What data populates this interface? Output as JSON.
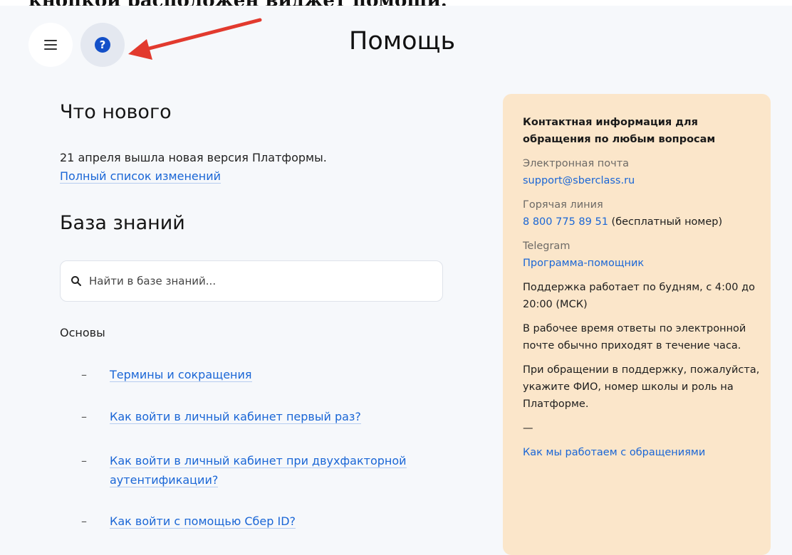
{
  "caption": "кнопкой расположен виджет помощи.",
  "header": {
    "title": "Помощь"
  },
  "whats_new": {
    "heading": "Что нового",
    "text": "21 апреля вышла новая версия Платформы.",
    "link": "Полный список изменений"
  },
  "knowledge_base": {
    "heading": "База знаний",
    "search_placeholder": "Найти в базе знаний...",
    "section": "Основы",
    "items": [
      {
        "label": "Термины и сокращения"
      },
      {
        "label": "Как войти в личный кабинет первый раз?"
      },
      {
        "label": "Как войти в личный кабинет при двухфакторной аутентификации?"
      },
      {
        "label": "Как войти с помощью Сбер ID?"
      }
    ]
  },
  "contact": {
    "title": "Контактная информация для обращения по любым вопросам",
    "email_label": "Электронная почта",
    "email": "support@sberclass.ru",
    "hotline_label": "Горячая линия",
    "phone": "8 800 775 89 51",
    "phone_note": "(бесплатный номер)",
    "telegram_label": "Telegram",
    "telegram_link": "Программа-помощник",
    "hours": "Поддержка работает по будням, с 4:00 до 20:00 (МСК)",
    "response": "В рабочее время ответы по электронной почте обычно приходят в течение часа.",
    "request_note": "При обращении в поддержку, пожалуйста, укажите ФИО, номер школы и роль на Платформе.",
    "separator": "—",
    "policy_link": "Как мы работаем с обращениями"
  },
  "colors": {
    "accent": "#1a66d6",
    "card_bg": "#fbe6ca",
    "arrow": "#e23a2e"
  },
  "icons": {
    "menu": "hamburger-icon",
    "help": "help-question-icon",
    "search": "search-icon"
  }
}
